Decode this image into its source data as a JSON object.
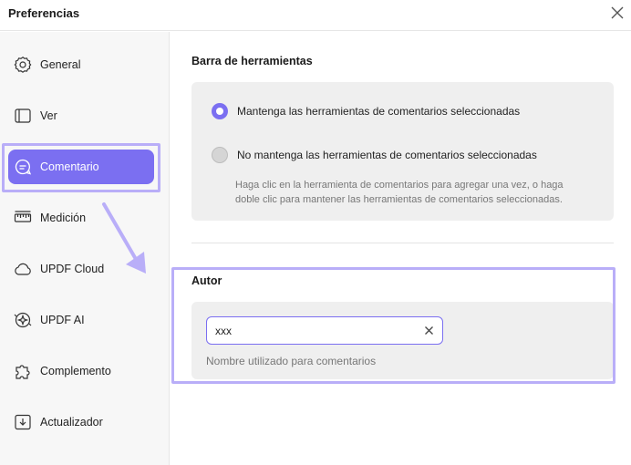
{
  "window": {
    "title": "Preferencias"
  },
  "sidebar": {
    "items": [
      {
        "label": "General",
        "icon": "gear-icon"
      },
      {
        "label": "Ver",
        "icon": "view-icon"
      },
      {
        "label": "Comentario",
        "icon": "comment-icon"
      },
      {
        "label": "Medición",
        "icon": "ruler-icon"
      },
      {
        "label": "UPDF Cloud",
        "icon": "cloud-icon"
      },
      {
        "label": "UPDF AI",
        "icon": "ai-icon"
      },
      {
        "label": "Complemento",
        "icon": "puzzle-icon"
      },
      {
        "label": "Actualizador",
        "icon": "update-icon"
      }
    ],
    "active_index": 2
  },
  "toolbar_section": {
    "title": "Barra de herramientas",
    "option_keep": "Mantenga las herramientas de comentarios seleccionadas",
    "option_no_keep": "No mantenga las herramientas de comentarios seleccionadas",
    "hint_line1": "Haga clic en la herramienta de comentarios para agregar una vez, o haga",
    "hint_line2": "doble clic para mantener las herramientas de comentarios seleccionadas.",
    "selected": "option_keep"
  },
  "author_section": {
    "title": "Autor",
    "value": "xxx",
    "hint": "Nombre utilizado para comentarios"
  },
  "colors": {
    "accent": "#7b6ff1",
    "highlight": "#b9aef8",
    "panel": "#efefef",
    "sidebar": "#f7f7f7"
  }
}
